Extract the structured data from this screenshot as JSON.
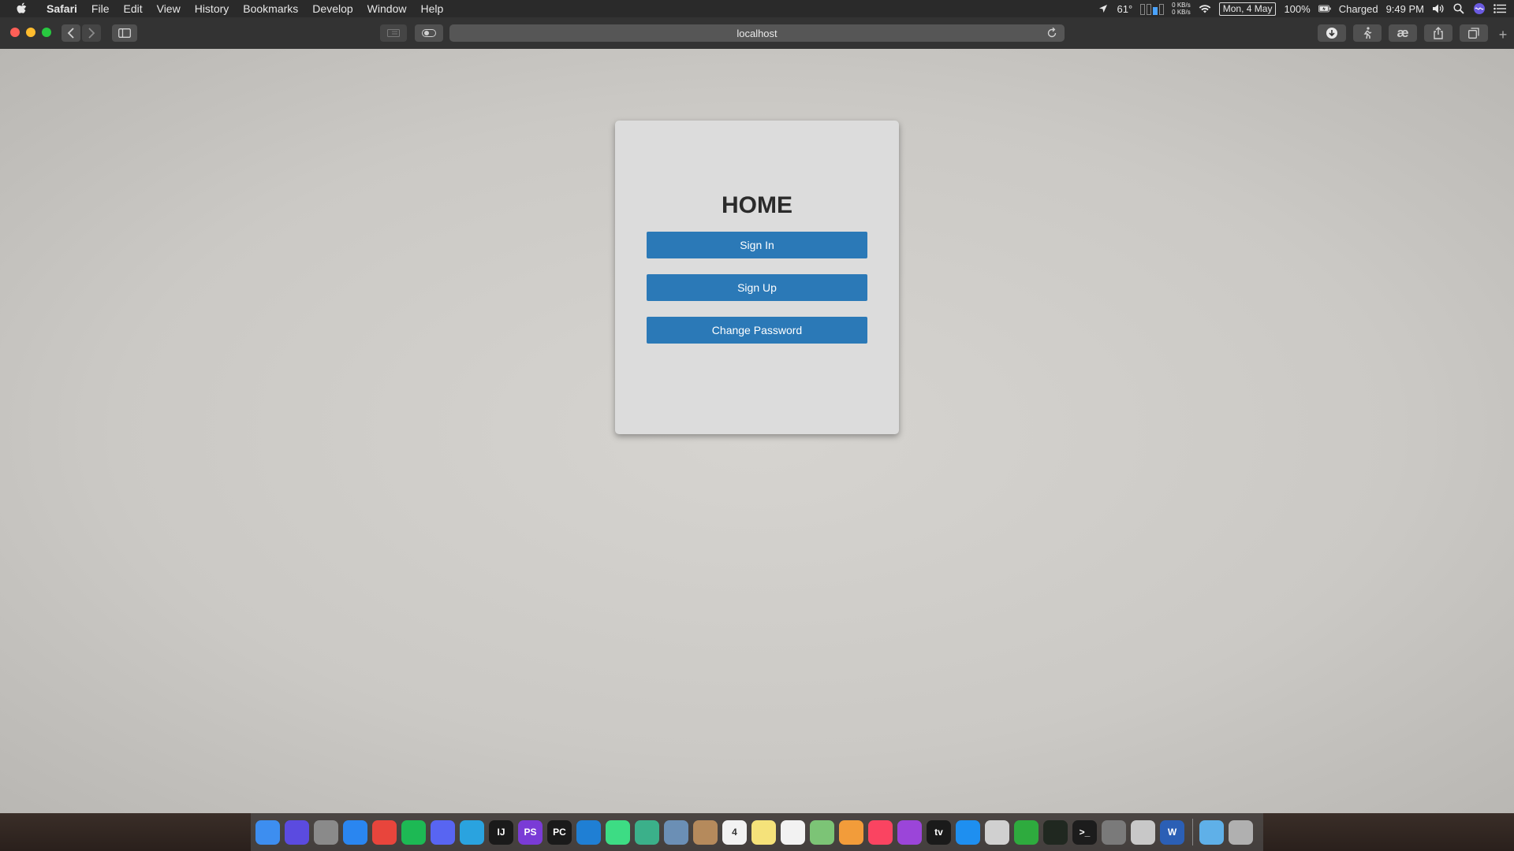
{
  "menubar": {
    "app_name": "Safari",
    "menus": [
      "File",
      "Edit",
      "View",
      "History",
      "Bookmarks",
      "Develop",
      "Window",
      "Help"
    ],
    "temperature": "61°",
    "net_up": "0 KB/s",
    "net_down": "0 KB/s",
    "date": "Mon, 4 May",
    "battery": "100%",
    "battery_status": "Charged",
    "time": "9:49 PM"
  },
  "toolbar": {
    "url": "localhost",
    "new_tab": "+"
  },
  "page": {
    "title": "HOME",
    "buttons": {
      "sign_in": "Sign In",
      "sign_up": "Sign Up",
      "change_password": "Change Password"
    },
    "button_color": "#2b79b7"
  },
  "dock": {
    "apps": [
      {
        "name": "finder-icon",
        "label": "",
        "color": "#3d8ef0"
      },
      {
        "name": "siri-icon",
        "label": "",
        "color": "#5b4be0"
      },
      {
        "name": "launchpad-icon",
        "label": "",
        "color": "#8a8a8a"
      },
      {
        "name": "safari-icon",
        "label": "",
        "color": "#2a86f0"
      },
      {
        "name": "chrome-icon",
        "label": "",
        "color": "#e8453c"
      },
      {
        "name": "spotify-icon",
        "label": "",
        "color": "#1db954"
      },
      {
        "name": "discord-icon",
        "label": "",
        "color": "#5865f2"
      },
      {
        "name": "telegram-icon",
        "label": "",
        "color": "#2aa3df"
      },
      {
        "name": "intellij-icon",
        "label": "IJ",
        "color": "#1a1a1a"
      },
      {
        "name": "phpstorm-icon",
        "label": "PS",
        "color": "#7a3bd6"
      },
      {
        "name": "pycharm-icon",
        "label": "PC",
        "color": "#1a1a1a"
      },
      {
        "name": "vscode-icon",
        "label": "",
        "color": "#1f7fd4"
      },
      {
        "name": "android-studio-icon",
        "label": "",
        "color": "#3ddc84"
      },
      {
        "name": "atom-icon",
        "label": "",
        "color": "#3bb08a"
      },
      {
        "name": "preview-icon",
        "label": "",
        "color": "#6b8fb5"
      },
      {
        "name": "contacts-icon",
        "label": "",
        "color": "#b58a5c"
      },
      {
        "name": "calendar-icon",
        "label": "4",
        "color": "#f2f2f2"
      },
      {
        "name": "notes-icon",
        "label": "",
        "color": "#f5e27a"
      },
      {
        "name": "reminders-icon",
        "label": "",
        "color": "#f2f2f2"
      },
      {
        "name": "maps-icon",
        "label": "",
        "color": "#7cc476"
      },
      {
        "name": "photos-icon",
        "label": "",
        "color": "#f29c3a"
      },
      {
        "name": "music-icon",
        "label": "",
        "color": "#fa4461"
      },
      {
        "name": "podcasts-icon",
        "label": "",
        "color": "#9b45d9"
      },
      {
        "name": "apple-tv-icon",
        "label": "tv",
        "color": "#1a1a1a"
      },
      {
        "name": "app-store-icon",
        "label": "",
        "color": "#1e8ff0"
      },
      {
        "name": "security-agent-icon",
        "label": "",
        "color": "#d0d0d0"
      },
      {
        "name": "globe-app-icon",
        "label": "",
        "color": "#2eab3e"
      },
      {
        "name": "activity-monitor-icon",
        "label": "",
        "color": "#202820"
      },
      {
        "name": "terminal-icon",
        "label": ">_",
        "color": "#1c1c1c"
      },
      {
        "name": "system-preferences-icon",
        "label": "",
        "color": "#7a7a7a"
      },
      {
        "name": "script-editor-icon",
        "label": "",
        "color": "#c8c8c8"
      },
      {
        "name": "word-icon",
        "label": "W",
        "color": "#2b5fb5"
      }
    ],
    "folders": [
      {
        "name": "downloads-folder-icon",
        "color": "#5fb0e8"
      },
      {
        "name": "trash-icon",
        "color": "#b0b0b0"
      }
    ]
  }
}
